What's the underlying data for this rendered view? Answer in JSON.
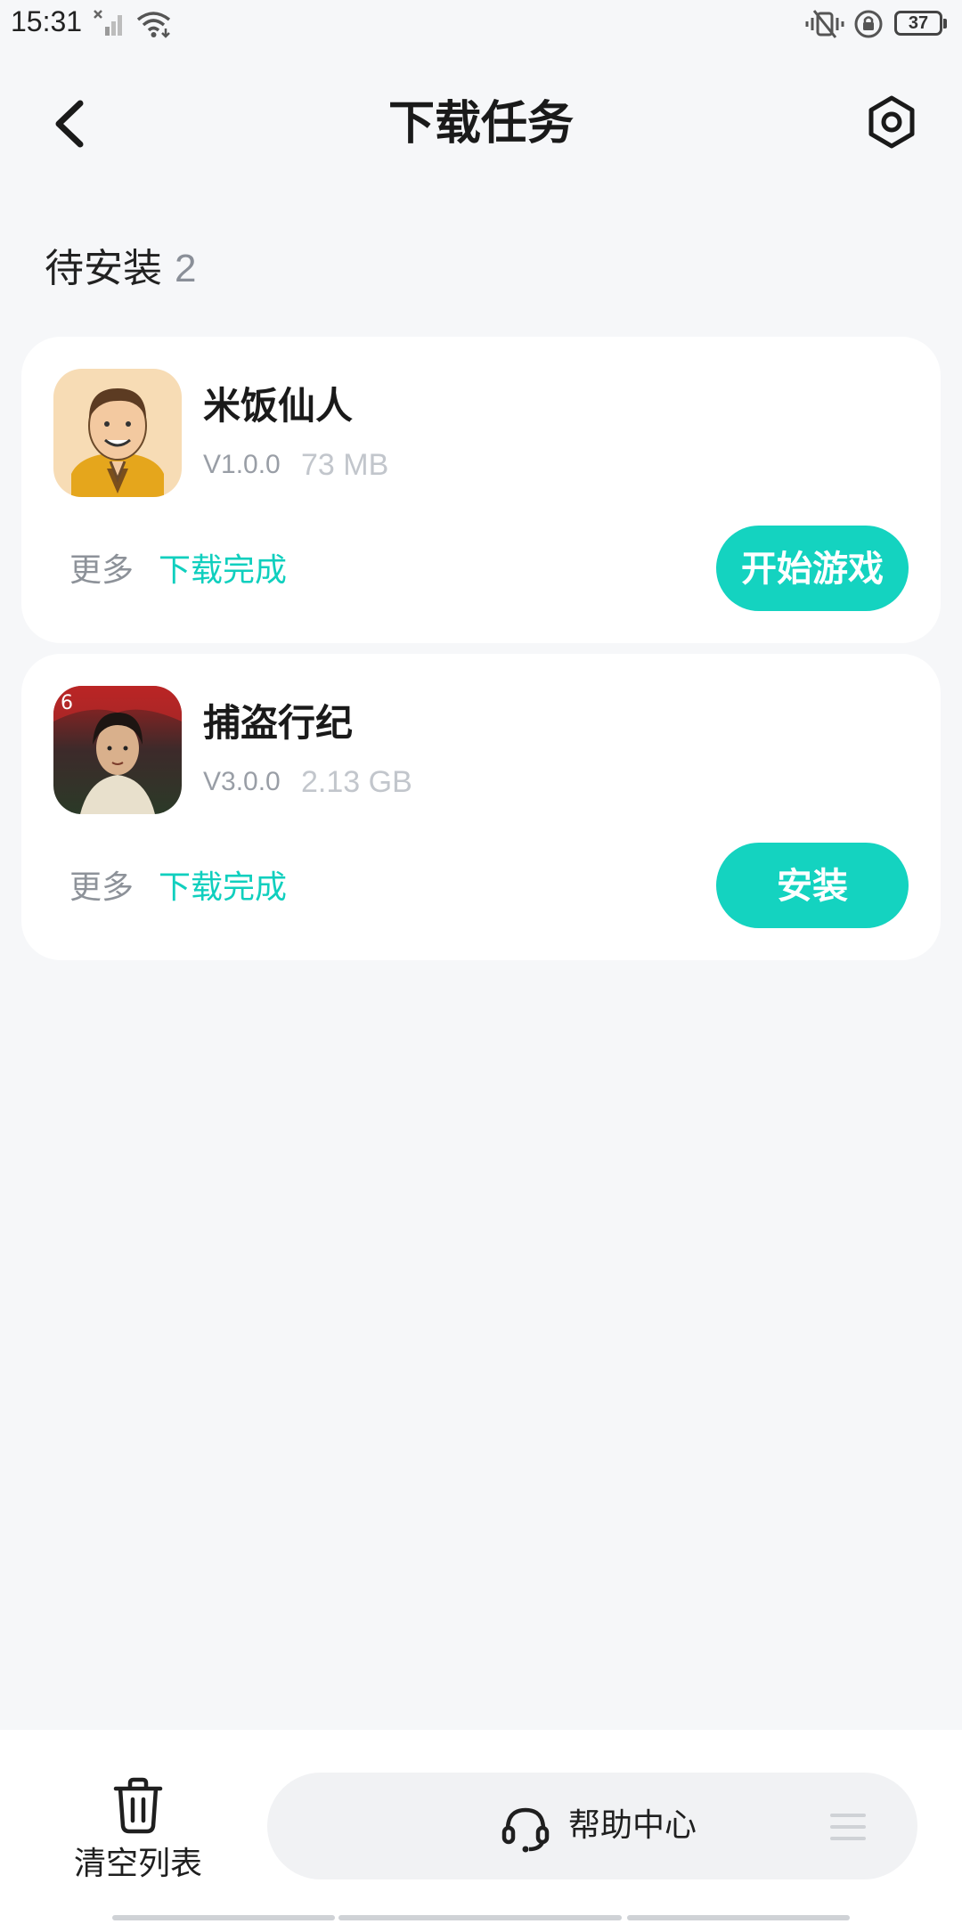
{
  "status_bar": {
    "time": "15:31",
    "battery": "37",
    "signal_icon": "signal-x-icon",
    "wifi_icon": "wifi-icon",
    "mute_icon": "vibrate-mute-icon",
    "lock_icon": "rotation-lock-icon"
  },
  "header": {
    "title": "下载任务",
    "back_icon": "chevron-left-icon",
    "settings_icon": "hexagon-settings-icon"
  },
  "section": {
    "label": "待安装",
    "count": "2"
  },
  "tasks": [
    {
      "name": "米饭仙人",
      "version": "V1.0.0",
      "size": "73 MB",
      "more": "更多",
      "status": "下载完成",
      "action": "开始游戏"
    },
    {
      "name": "捕盗行纪",
      "version": "V3.0.0",
      "size": "2.13 GB",
      "more": "更多",
      "status": "下载完成",
      "action": "安装"
    }
  ],
  "bottom_bar": {
    "clear_label": "清空列表",
    "clear_icon": "trash-icon",
    "help_label": "帮助中心",
    "help_icon": "headset-icon",
    "menu_icon": "menu-icon"
  },
  "colors": {
    "accent": "#14d3c0",
    "status_text": "#10cfbe",
    "background": "#f6f7f9",
    "card": "#ffffff"
  }
}
